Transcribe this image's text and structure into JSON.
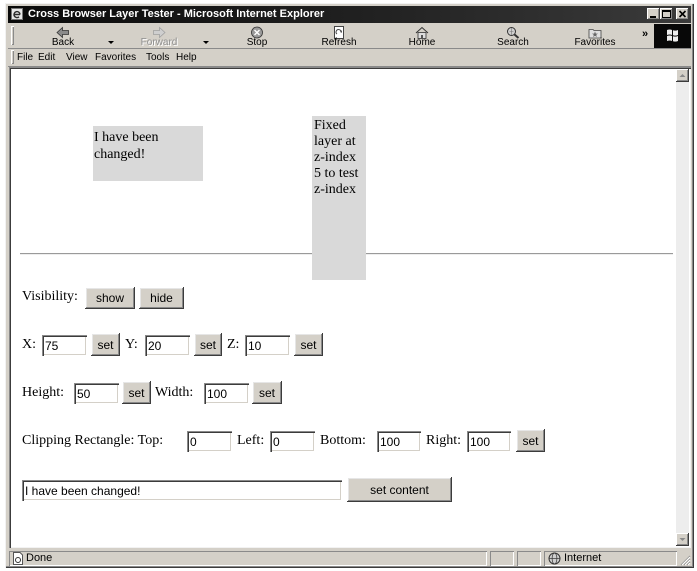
{
  "window": {
    "title": "Cross Browser Layer Tester - Microsoft Internet Explorer"
  },
  "toolbar": {
    "back": "Back",
    "forward": "Forward",
    "stop": "Stop",
    "refresh": "Refresh",
    "home": "Home",
    "search": "Search",
    "favorites": "Favorites",
    "more": "»"
  },
  "menu": [
    "File",
    "Edit",
    "View",
    "Favorites",
    "Tools",
    "Help"
  ],
  "page": {
    "changed_layer_text": "I have been changed!",
    "fixed_layer_text": "Fixed layer at z-index 5 to test z-index",
    "visibility": {
      "label": "Visibility:",
      "show": "show",
      "hide": "hide"
    },
    "position": {
      "x_label": "X:",
      "x_value": "75",
      "x_set": "set",
      "y_label": "Y:",
      "y_value": "20",
      "y_set": "set",
      "z_label": "Z:",
      "z_value": "10",
      "z_set": "set"
    },
    "size": {
      "height_label": "Height:",
      "height_value": "50",
      "height_set": "set",
      "width_label": "Width:",
      "width_value": "100",
      "width_set": "set"
    },
    "clipping": {
      "top_label": "Clipping Rectangle: Top:",
      "top_value": "0",
      "left_label": "Left:",
      "left_value": "0",
      "bottom_label": "Bottom:",
      "bottom_value": "100",
      "right_label": "Right:",
      "right_value": "100",
      "set": "set"
    },
    "content": {
      "value": "I have been changed!",
      "button": "set content"
    }
  },
  "status": {
    "text": "Done",
    "zone": "Internet"
  },
  "icons": {
    "app": "ie-page-icon",
    "back": "back-arrow-icon",
    "forward": "forward-arrow-icon",
    "stop": "stop-icon",
    "refresh": "refresh-icon",
    "home": "home-icon",
    "search": "search-icon",
    "favorites": "favorites-folder-icon",
    "brand": "windows-logo-icon",
    "status_page": "page-done-icon",
    "zone": "globe-icon"
  },
  "colors": {
    "chrome": "#d4d0c8",
    "title_bar": "#1a1a1a",
    "layer_background": "#d9d9d9",
    "page_background": "#ffffff"
  }
}
